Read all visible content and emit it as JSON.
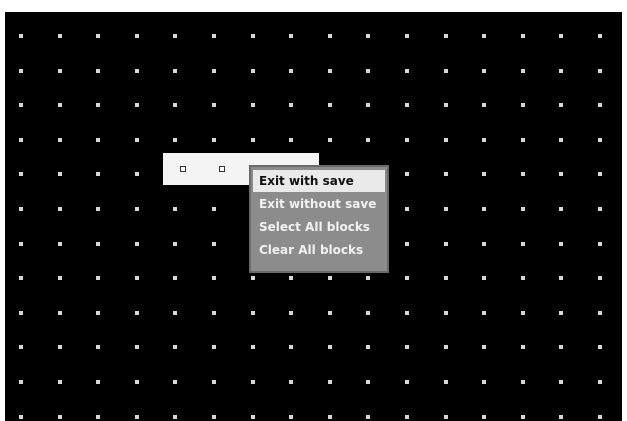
{
  "canvas": {
    "background_color": "#000000",
    "dot_color": "#d8d8d8",
    "selection_color": "#f4f4f4"
  },
  "context_menu": {
    "items": [
      {
        "label": "Exit with save",
        "highlighted": true
      },
      {
        "label": "Exit without save",
        "highlighted": false
      },
      {
        "label": "Select All blocks",
        "highlighted": false
      },
      {
        "label": "Clear All blocks",
        "highlighted": false
      }
    ]
  }
}
